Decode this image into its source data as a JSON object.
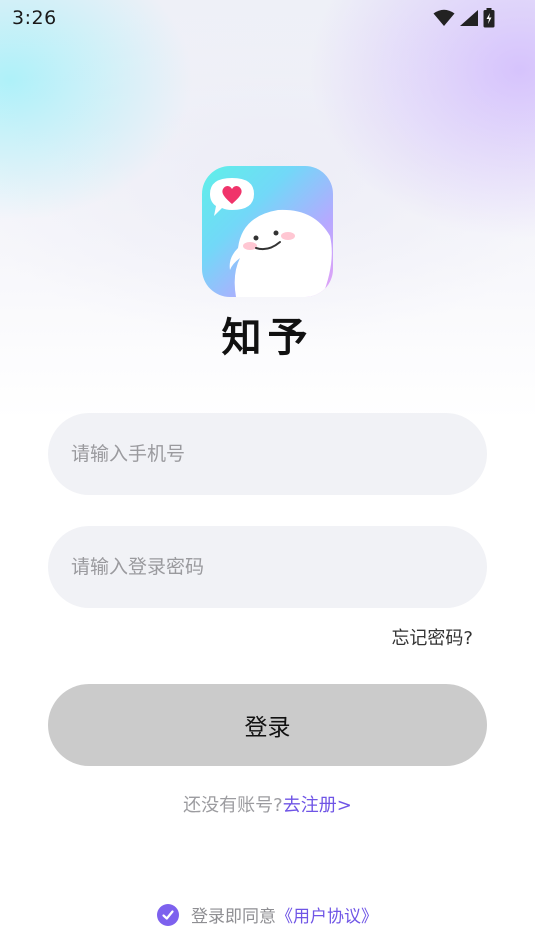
{
  "status_bar": {
    "time": "3:26",
    "icons": [
      "wifi-icon",
      "signal-icon",
      "battery-charging-icon"
    ]
  },
  "app": {
    "name": "知予",
    "logo_icon": "app-logo-icon"
  },
  "form": {
    "phone_placeholder": "请输入手机号",
    "phone_value": "",
    "password_placeholder": "请输入登录密码",
    "password_value": "",
    "forgot_label": "忘记密码?",
    "login_label": "登录"
  },
  "register": {
    "prompt": "还没有账号?",
    "link": "去注册>"
  },
  "agreement": {
    "checked": true,
    "text": "登录即同意",
    "link": "《用户协议》"
  },
  "colors": {
    "accent": "#7d61ee",
    "link": "#6f55e6",
    "button_disabled": "#cbcbcb",
    "input_bg": "#f1f2f6"
  }
}
